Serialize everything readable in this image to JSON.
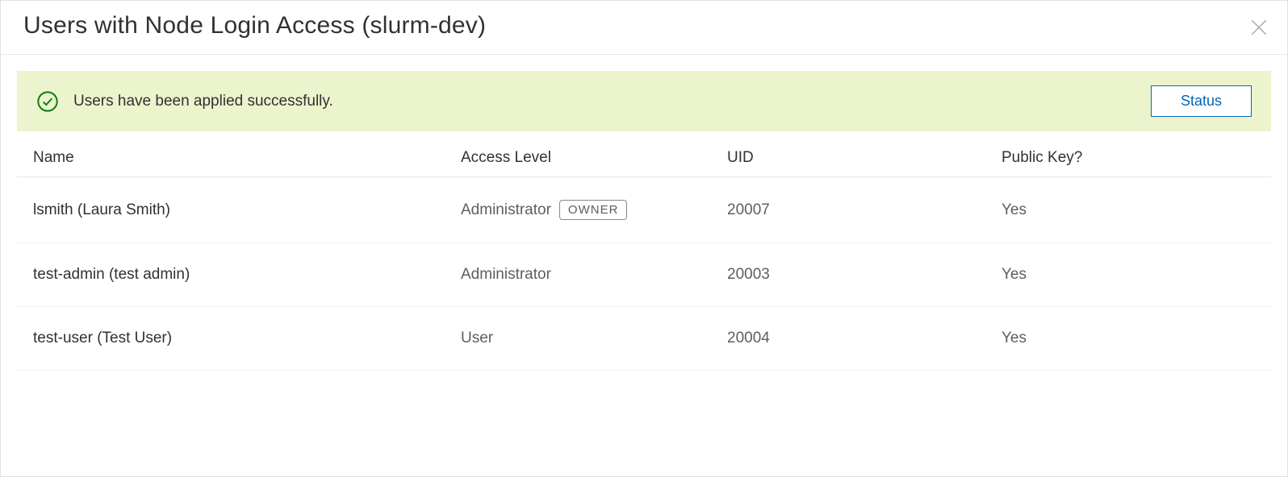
{
  "dialog": {
    "title": "Users with Node Login Access (slurm-dev)"
  },
  "banner": {
    "message": "Users have been applied successfully.",
    "status_button": "Status"
  },
  "table": {
    "headers": {
      "name": "Name",
      "access_level": "Access Level",
      "uid": "UID",
      "public_key": "Public Key?"
    },
    "rows": [
      {
        "name": "lsmith (Laura Smith)",
        "access_level": "Administrator",
        "owner_badge": "OWNER",
        "uid": "20007",
        "public_key": "Yes"
      },
      {
        "name": "test-admin (test admin)",
        "access_level": "Administrator",
        "owner_badge": "",
        "uid": "20003",
        "public_key": "Yes"
      },
      {
        "name": "test-user (Test User)",
        "access_level": "User",
        "owner_badge": "",
        "uid": "20004",
        "public_key": "Yes"
      }
    ]
  }
}
